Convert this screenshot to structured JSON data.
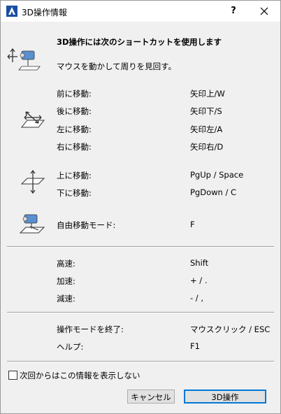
{
  "window": {
    "title": "3D操作情報",
    "help_label": "?"
  },
  "intro": {
    "heading": "3D操作には次のショートカットを使用します",
    "look_around": "マウスを動かして周りを見回す。"
  },
  "move_horizontal": [
    {
      "label": "前に移動:",
      "key": "矢印上/W"
    },
    {
      "label": "後に移動:",
      "key": "矢印下/S"
    },
    {
      "label": "左に移動:",
      "key": "矢印左/A"
    },
    {
      "label": "右に移動:",
      "key": "矢印右/D"
    }
  ],
  "move_vertical": [
    {
      "label": "上に移動:",
      "key": "PgUp / Space"
    },
    {
      "label": "下に移動:",
      "key": "PgDown / C"
    }
  ],
  "free_mode": {
    "label": "自由移動モード:",
    "key": "F"
  },
  "speed": [
    {
      "label": "高速:",
      "key": "Shift"
    },
    {
      "label": "加速:",
      "key": "+ / ."
    },
    {
      "label": "減速:",
      "key": "- / ,"
    }
  ],
  "other": [
    {
      "label": "操作モードを終了:",
      "key": "マウスクリック / ESC"
    },
    {
      "label": "ヘルプ:",
      "key": "F1"
    }
  ],
  "footer": {
    "checkbox_label": "次回からはこの情報を表示しない",
    "cancel_label": "キャンセル",
    "ok_label": "3D操作"
  },
  "colors": {
    "accent": "#0078d7",
    "dialog_bg": "#f0f0f0",
    "titlebar_bg": "#ffffff"
  },
  "icons": [
    "archicad-logo-icon",
    "orbit-camera-icon",
    "move-horizontal-icon",
    "move-vertical-icon",
    "free-move-camera-icon",
    "close-icon"
  ]
}
